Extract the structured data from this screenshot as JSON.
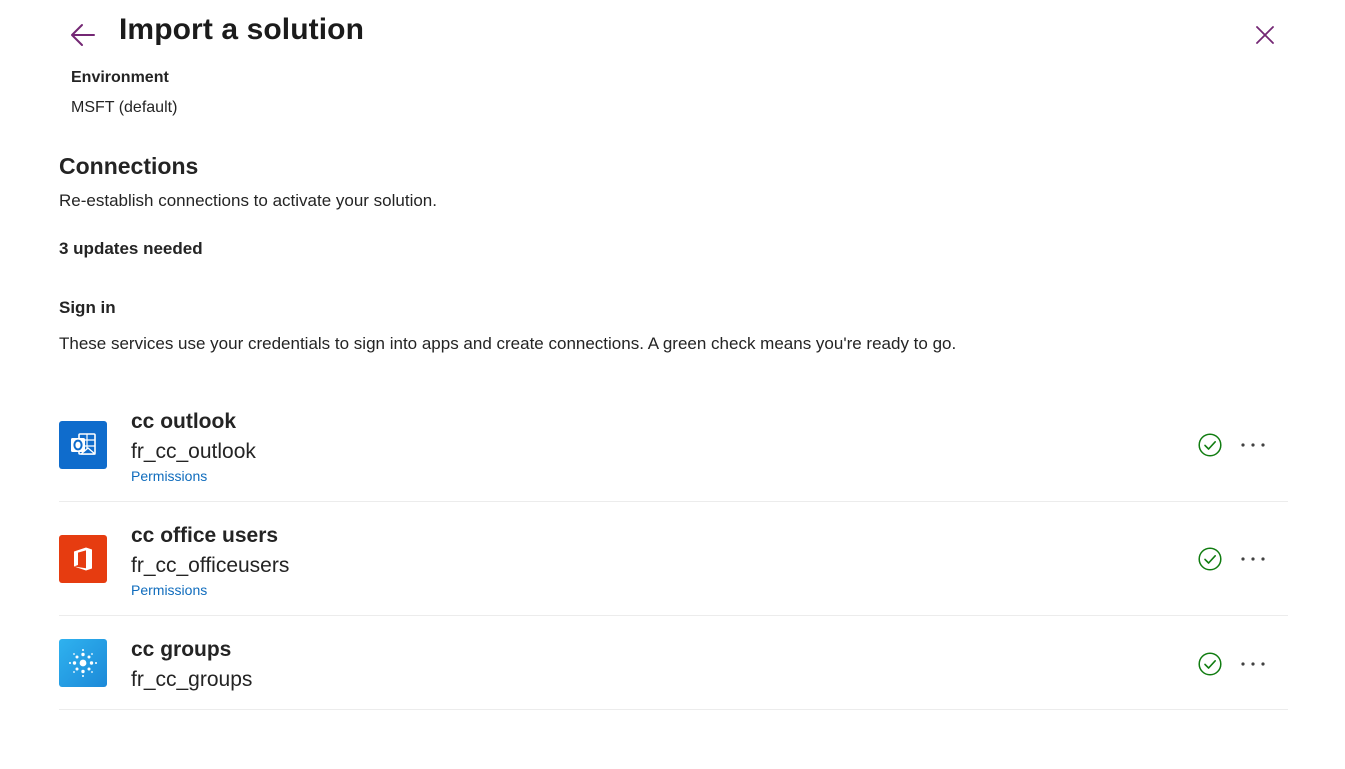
{
  "header": {
    "title": "Import a solution",
    "back_icon": "arrow-left-icon",
    "close_icon": "close-icon",
    "accent_color": "#742774"
  },
  "environment": {
    "label": "Environment",
    "value": "MSFT (default)"
  },
  "connections": {
    "heading": "Connections",
    "description": "Re-establish connections to activate your solution.",
    "updates_needed": "3 updates needed"
  },
  "sign_in": {
    "heading": "Sign in",
    "description": "These services use your credentials to sign into apps and create connections. A green check means you're ready to go."
  },
  "services": [
    {
      "name": "cc outlook",
      "connection": "fr_cc_outlook",
      "permissions_label": "Permissions",
      "icon": "outlook-icon",
      "icon_color": "#0f6ccc",
      "status": "ready",
      "status_icon": "check-circle-icon"
    },
    {
      "name": "cc office users",
      "connection": "fr_cc_officeusers",
      "permissions_label": "Permissions",
      "icon": "office-icon",
      "icon_color": "#e63c10",
      "status": "ready",
      "status_icon": "check-circle-icon"
    },
    {
      "name": "cc groups",
      "connection": "fr_cc_groups",
      "icon": "groups-icon",
      "icon_color": "#1c89d8",
      "status": "ready",
      "status_icon": "check-circle-icon"
    }
  ],
  "status_color": "#107c10",
  "link_color": "#0f6cbd"
}
